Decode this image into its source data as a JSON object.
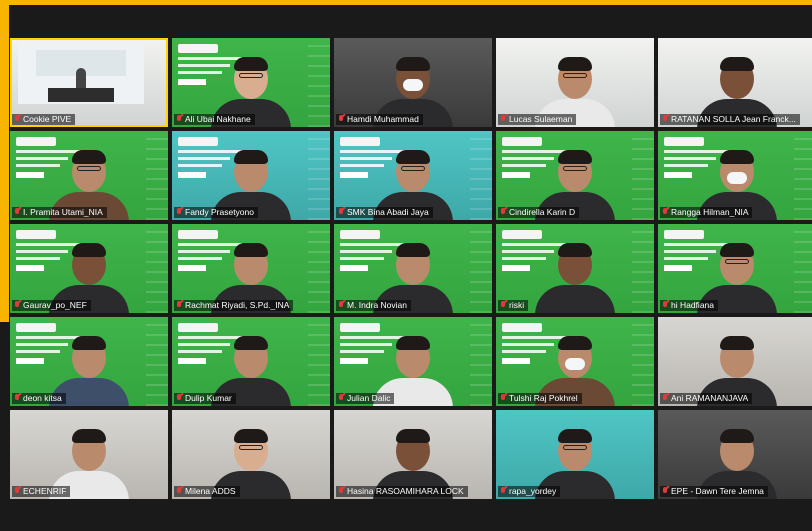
{
  "accent_color": "#f7b500",
  "tiles": [
    {
      "name": "Cookie PIVE",
      "bg": "white",
      "kind": "stage",
      "active": true
    },
    {
      "name": "Ali Ubai Nakhane",
      "bg": "green",
      "kind": "slide",
      "skin": "light",
      "outfit": "dark",
      "glasses": true
    },
    {
      "name": "Hamdi Muhammad",
      "bg": "room",
      "kind": "person",
      "skin": "dark",
      "outfit": "dark",
      "mask": true
    },
    {
      "name": "Lucas Sulaeman",
      "bg": "white",
      "kind": "person",
      "skin": "mid",
      "outfit": "white",
      "glasses": true
    },
    {
      "name": "RATANAN SOLLA Jean Franck...",
      "bg": "white",
      "kind": "person",
      "skin": "dark",
      "outfit": "dark"
    },
    {
      "name": "I. Pramita Utami_NIA",
      "bg": "green",
      "kind": "slide",
      "skin": "mid",
      "outfit": "brown",
      "glasses": true
    },
    {
      "name": "Fandy Prasetyono",
      "bg": "teal",
      "kind": "slide",
      "skin": "mid",
      "outfit": "dark"
    },
    {
      "name": "SMK Bina Abadi Jaya",
      "bg": "teal",
      "kind": "slide",
      "skin": "mid",
      "outfit": "dark",
      "glasses": true
    },
    {
      "name": "Cindirella Karin D",
      "bg": "green",
      "kind": "slide",
      "skin": "mid",
      "outfit": "dark",
      "glasses": true
    },
    {
      "name": "Rangga Hilman_NIA",
      "bg": "green",
      "kind": "slide",
      "skin": "mid",
      "outfit": "dark",
      "mask": true
    },
    {
      "name": "Gaurav_po_NEF",
      "bg": "green",
      "kind": "slide",
      "skin": "dark",
      "outfit": "dark"
    },
    {
      "name": "Rachmat Riyadi, S.Pd._INA",
      "bg": "green",
      "kind": "slide",
      "skin": "mid",
      "outfit": "dark"
    },
    {
      "name": "M. Indra Novian",
      "bg": "green",
      "kind": "slide",
      "skin": "mid",
      "outfit": "dark"
    },
    {
      "name": "riski",
      "bg": "green",
      "kind": "slide",
      "skin": "dark",
      "outfit": "dark"
    },
    {
      "name": "hi Hadfiana",
      "bg": "green",
      "kind": "slide",
      "skin": "mid",
      "outfit": "dark",
      "glasses": true
    },
    {
      "name": "deon kitsa",
      "bg": "green",
      "kind": "slide",
      "skin": "mid",
      "outfit": "blue"
    },
    {
      "name": "Dulip Kumar",
      "bg": "green",
      "kind": "slide",
      "skin": "mid",
      "outfit": "dark"
    },
    {
      "name": "Julian Dalic",
      "bg": "green",
      "kind": "slide",
      "skin": "mid",
      "outfit": "white"
    },
    {
      "name": "Tulshi Raj Pokhrel",
      "bg": "green",
      "kind": "slide",
      "skin": "mid",
      "outfit": "brown",
      "mask": true
    },
    {
      "name": "Ani RAMANANJAVA",
      "bg": "light",
      "kind": "person",
      "skin": "mid",
      "outfit": "dark"
    },
    {
      "name": "ECHENRIF",
      "bg": "light",
      "kind": "person",
      "skin": "mid",
      "outfit": "white"
    },
    {
      "name": "Milena ADDS",
      "bg": "light",
      "kind": "person",
      "skin": "light",
      "outfit": "dark",
      "glasses": true
    },
    {
      "name": "Hasina RASOAMIHARA LOCK",
      "bg": "light",
      "kind": "person",
      "skin": "dark",
      "outfit": "dark"
    },
    {
      "name": "rapa_yordey",
      "bg": "teal",
      "kind": "person",
      "skin": "mid",
      "outfit": "dark",
      "glasses": true
    },
    {
      "name": "EPE - Dawn Tere Jemna",
      "bg": "room",
      "kind": "person",
      "skin": "mid",
      "outfit": "dark"
    }
  ]
}
